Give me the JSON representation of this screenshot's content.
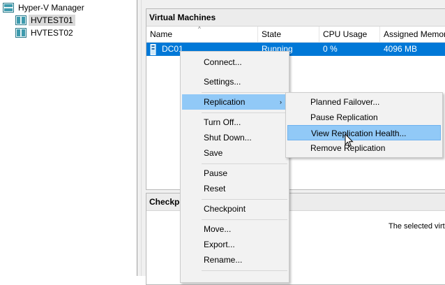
{
  "tree": {
    "root": "Hyper-V Manager",
    "servers": [
      "HVTEST01",
      "HVTEST02"
    ]
  },
  "vm_panel": {
    "title": "Virtual Machines",
    "columns": [
      "Name",
      "State",
      "CPU Usage",
      "Assigned Memor"
    ],
    "rows": [
      {
        "name": "DC01",
        "state": "Running",
        "cpu": "0 %",
        "memory": "4096 MB"
      }
    ]
  },
  "checkpoint_panel": {
    "title": "Checkpo",
    "message": "The selected virtu"
  },
  "context_menu": {
    "items": [
      "Connect...",
      "Settings...",
      "Replication",
      "Turn Off...",
      "Shut Down...",
      "Save",
      "Pause",
      "Reset",
      "Checkpoint",
      "Move...",
      "Export...",
      "Rename..."
    ],
    "submenu_arrow": "›"
  },
  "replication_menu": {
    "items": [
      "Planned Failover...",
      "Pause Replication",
      "View Replication Health...",
      "Remove Replication"
    ]
  },
  "colors": {
    "selection": "#0078d7",
    "menu_highlight": "#91c9f7"
  }
}
